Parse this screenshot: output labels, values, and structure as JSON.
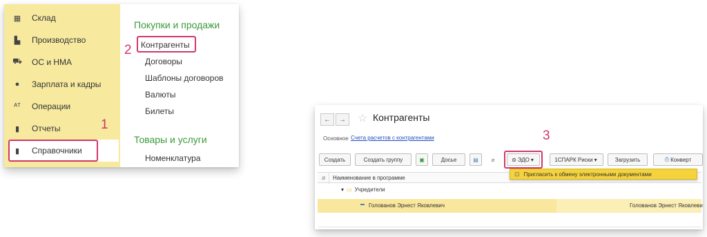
{
  "menu": {
    "sidebar_items": [
      {
        "label": "Склад",
        "icon": "warehouse-icon",
        "glyph": "▦"
      },
      {
        "label": "Производство",
        "icon": "factory-icon",
        "glyph": "▙"
      },
      {
        "label": "ОС и НМА",
        "icon": "truck-icon",
        "glyph": "⛟"
      },
      {
        "label": "Зарплата и кадры",
        "icon": "person-icon",
        "glyph": "●"
      },
      {
        "label": "Операции",
        "icon": "operations-icon",
        "glyph": "ᴬᵀ"
      },
      {
        "label": "Отчеты",
        "icon": "bar-chart-icon",
        "glyph": "▮"
      },
      {
        "label": "Справочники",
        "icon": "book-icon",
        "glyph": "▮"
      }
    ],
    "group1_title": "Покупки и продажи",
    "group1_links": [
      "Контрагенты",
      "Договоры",
      "Шаблоны договоров",
      "Валюты",
      "Билеты"
    ],
    "group2_title": "Товары и услуги",
    "group2_links": [
      "Номенклатура"
    ],
    "step1": "1",
    "step2": "2"
  },
  "form": {
    "back_glyph": "←",
    "forward_glyph": "→",
    "star_glyph": "☆",
    "title": "Контрагенты",
    "tab_main": "Основное",
    "tab_link": "Счета расчетов с контрагентами",
    "buttons": {
      "create": "Создать",
      "create_group": "Создать группу",
      "dossier": "Досье",
      "edo": "ЭДО",
      "spark": "1СПАРК Риски",
      "load": "Загрузить",
      "envelope": "Конверт"
    },
    "step3": "3",
    "dropdown_item": "Пригласить к обмену электронными документами",
    "table_header": "Наименование в программе",
    "group_row": "Учредители",
    "row_name": "Голованов Эрнест Яковлевич",
    "row_name2": "Голованов Эрнест Яковлеви"
  },
  "colors": {
    "sidebar_bg": "#f7ea9f",
    "accent_highlight": "#d0356a",
    "group_title": "#3a9a3a",
    "selected_row": "#fbefb6",
    "dropdown_bg": "#f5d33c"
  }
}
